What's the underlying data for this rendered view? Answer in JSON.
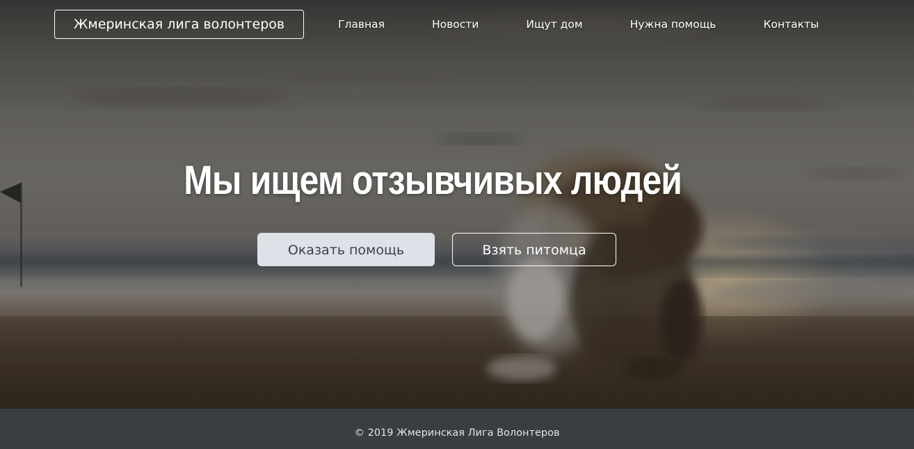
{
  "header": {
    "brand": "Жмеринская лига волонтеров",
    "nav": [
      {
        "label": "Главная"
      },
      {
        "label": "Новости"
      },
      {
        "label": "Ищут дом"
      },
      {
        "label": "Нужна помощь"
      },
      {
        "label": "Контакты"
      }
    ]
  },
  "hero": {
    "title": "Мы ищем отзывчивых людей",
    "primary_button": "Оказать помощь",
    "secondary_button": "Взять питомца",
    "background_image": "blurred-puppy-on-beach-at-sunset"
  },
  "footer": {
    "copyright": "© 2019 Жмеринская Лига Волонтеров"
  },
  "colors": {
    "primary_button_bg": "#dde1e8",
    "primary_button_text": "#3e4349",
    "footer_bg": "#3a3d41",
    "text_light": "#ffffff"
  }
}
